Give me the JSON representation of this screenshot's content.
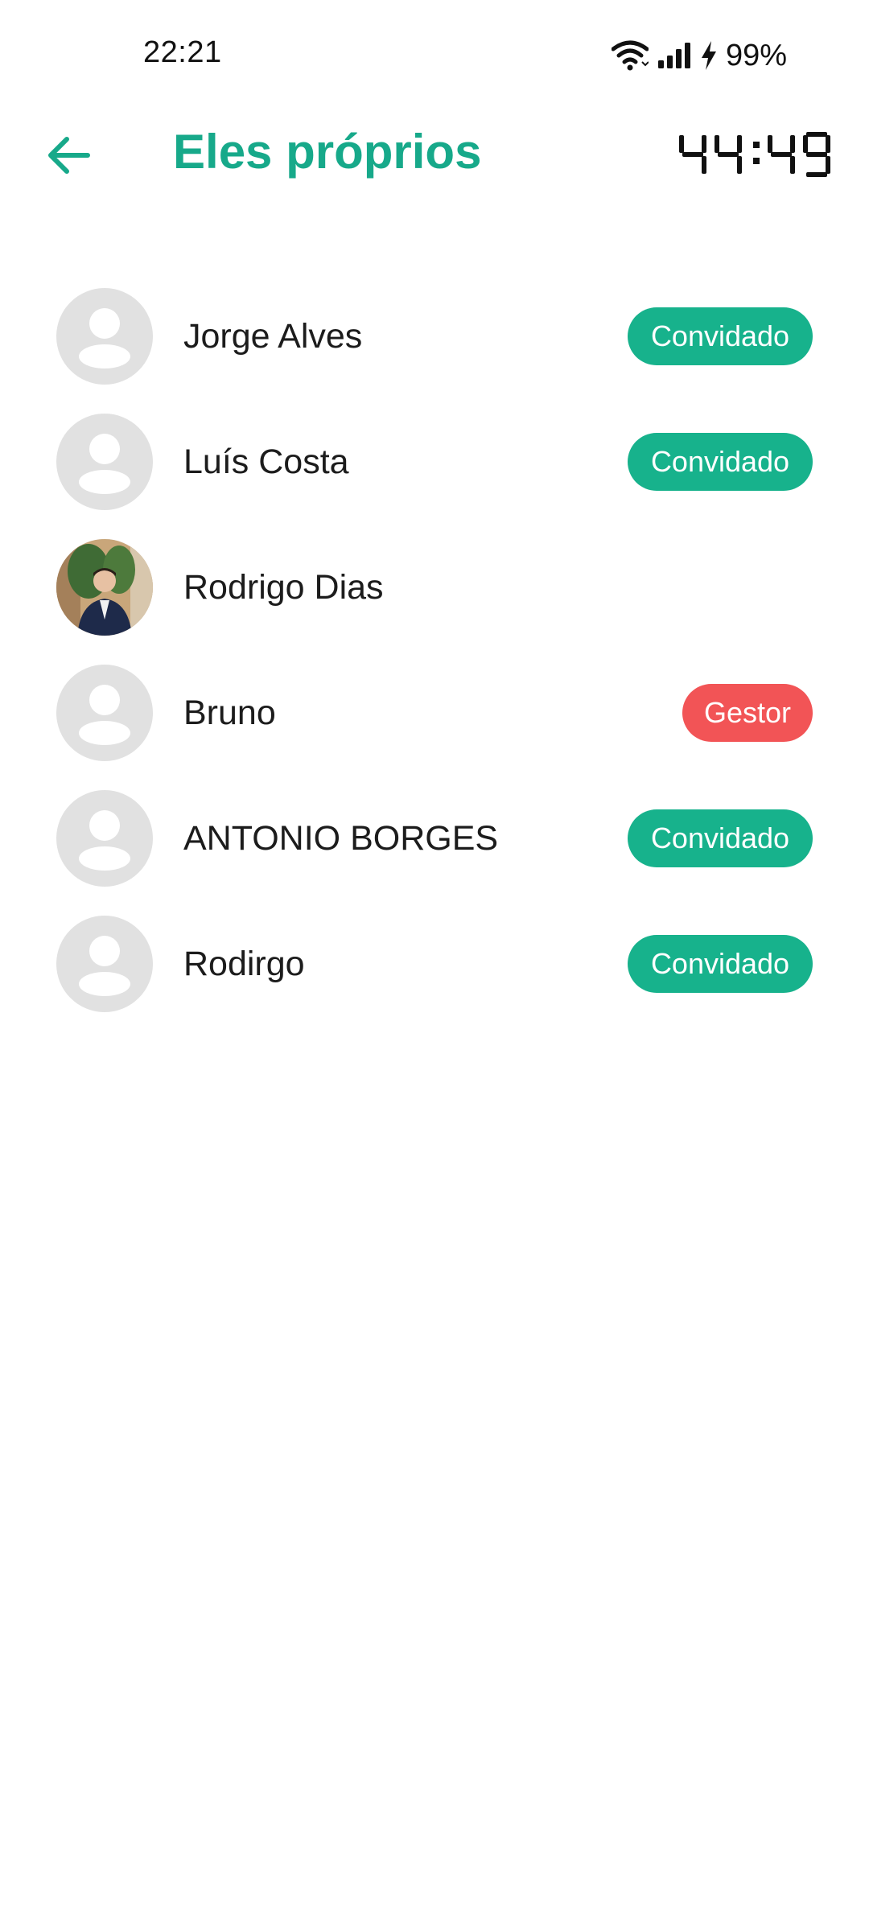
{
  "status_bar": {
    "time": "22:21",
    "battery": "99%",
    "icons": [
      "wifi-icon",
      "signal-icon",
      "charging-icon"
    ]
  },
  "header": {
    "back_icon": "arrow-left-icon",
    "title": "Eles próprios",
    "timer": "44:49"
  },
  "colors": {
    "accent": "#17a98a",
    "invited_badge": "#17b28c",
    "manager_badge": "#f25456",
    "avatar_placeholder": "#e1e1e1"
  },
  "members": [
    {
      "name": "Jorge Alves",
      "badge": "Convidado",
      "badge_type": "invited",
      "avatar": "placeholder"
    },
    {
      "name": "Luís Costa",
      "badge": "Convidado",
      "badge_type": "invited",
      "avatar": "placeholder"
    },
    {
      "name": "Rodrigo Dias",
      "badge": "",
      "badge_type": "none",
      "avatar": "photo"
    },
    {
      "name": "Bruno",
      "badge": "Gestor",
      "badge_type": "manager",
      "avatar": "placeholder"
    },
    {
      "name": "ANTONIO BORGES",
      "badge": "Convidado",
      "badge_type": "invited",
      "avatar": "placeholder"
    },
    {
      "name": "Rodirgo",
      "badge": "Convidado",
      "badge_type": "invited",
      "avatar": "placeholder"
    }
  ]
}
